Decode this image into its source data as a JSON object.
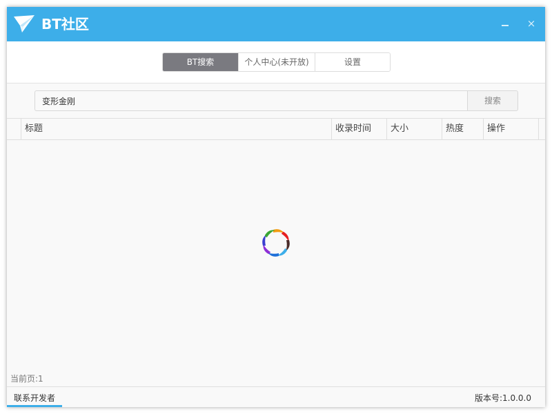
{
  "window": {
    "title": "BT社区",
    "minimize_icon": "minimize-icon",
    "close_label": "×"
  },
  "tabs": [
    {
      "label": "BT搜索",
      "active": true
    },
    {
      "label": "个人中心(未开放)",
      "active": false
    },
    {
      "label": "设置",
      "active": false
    }
  ],
  "search": {
    "value": "变形金刚",
    "button_label": "搜索"
  },
  "table": {
    "columns": [
      "标题",
      "收录时间",
      "大小",
      "热度",
      "操作"
    ],
    "rows": []
  },
  "status": {
    "loading_icon": "loading-spinner-icon",
    "page_info": "当前页:1"
  },
  "footer": {
    "contact_label": "联系开发者",
    "version": "版本号:1.0.0.0"
  },
  "colors": {
    "accent": "#3daee9",
    "active_tab": "#7a7a80"
  }
}
